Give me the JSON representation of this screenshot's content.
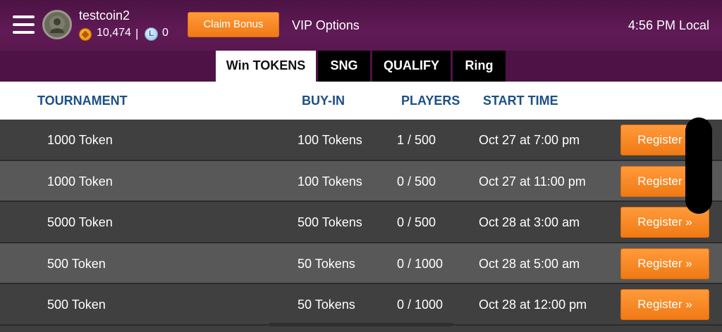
{
  "header": {
    "username": "testcoin2",
    "coins": "10,474",
    "separator": "|",
    "loyalty_letter": "L",
    "loyalty_points": "0",
    "claim_label": "Claim Bonus",
    "vip_label": "VIP Options",
    "time": "4:56 PM Local"
  },
  "tabs": [
    {
      "label": "Win TOKENS",
      "active": true
    },
    {
      "label": "SNG",
      "active": false
    },
    {
      "label": "QUALIFY",
      "active": false
    },
    {
      "label": "Ring",
      "active": false
    }
  ],
  "columns": [
    "TOURNAMENT",
    "BUY-IN",
    "PLAYERS",
    "START TIME"
  ],
  "rows": [
    {
      "name": "1000 Token",
      "buyin": "100 Tokens",
      "players": "1 / 500",
      "start": "Oct 27 at 7:00 pm",
      "action": "Register »"
    },
    {
      "name": "1000 Token",
      "buyin": "100 Tokens",
      "players": "0 / 500",
      "start": "Oct 27 at 11:00 pm",
      "action": "Register »"
    },
    {
      "name": "5000 Token",
      "buyin": "500 Tokens",
      "players": "0 / 500",
      "start": "Oct 28 at 3:00 am",
      "action": "Register »"
    },
    {
      "name": "500 Token",
      "buyin": "50 Tokens",
      "players": "0 / 1000",
      "start": "Oct 28 at 5:00 am",
      "action": "Register »"
    },
    {
      "name": "500 Token",
      "buyin": "50 Tokens",
      "players": "0 / 1000",
      "start": "Oct 28 at 12:00 pm",
      "action": "Register »"
    }
  ],
  "colors": {
    "header_bg": "#5f1a55",
    "accent_orange": "#f07a14",
    "column_header_text": "#1d4f86",
    "row_dark": "#404040",
    "row_light": "#585858"
  }
}
